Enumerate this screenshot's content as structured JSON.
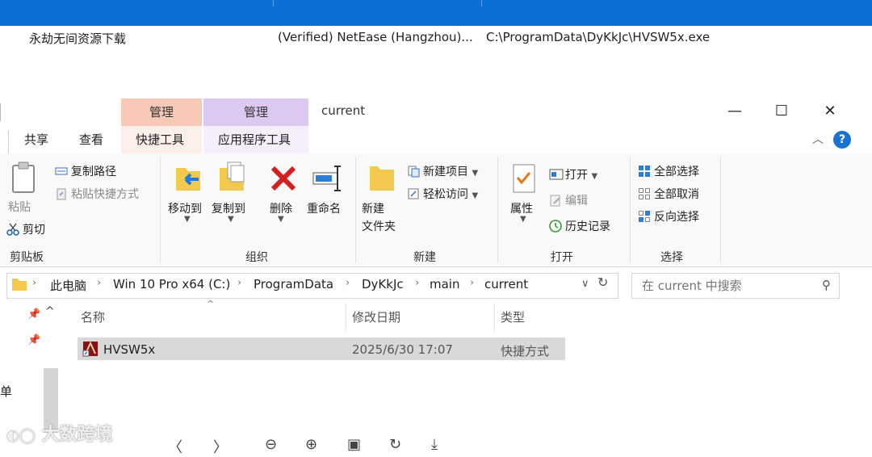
{
  "autoruns": {
    "entry": "永劫无间资源下载",
    "publisher": "(Verified) NetEase (Hangzhou)...",
    "path": "C:\\ProgramData\\DyKkJc\\HVSW5x.exe"
  },
  "window": {
    "title": "current",
    "context_tab_1": "管理",
    "context_tab_2": "管理",
    "minimize": "—",
    "maximize": "☐",
    "close": "✕"
  },
  "tabs": {
    "share": "共享",
    "view": "查看",
    "shortcut_tools": "快捷工具",
    "app_tools": "应用程序工具"
  },
  "ribbon": {
    "clipboard": {
      "paste": "粘贴",
      "copy_path": "复制路径",
      "paste_shortcut": "粘贴快捷方式",
      "cut": "剪切",
      "group": "剪贴板"
    },
    "organize": {
      "move_to": "移动到",
      "copy_to": "复制到",
      "delete": "删除",
      "rename": "重命名",
      "group": "组织"
    },
    "new": {
      "new_folder": "新建\n文件夹",
      "new_item": "新建项目",
      "easy_access": "轻松访问",
      "group": "新建"
    },
    "open": {
      "properties": "属性",
      "open": "打开",
      "edit": "编辑",
      "history": "历史记录",
      "group": "打开"
    },
    "select": {
      "select_all": "全部选择",
      "select_none": "全部取消",
      "invert": "反向选择",
      "group": "选择"
    }
  },
  "address": {
    "crumbs": [
      "此电脑",
      "Win 10 Pro x64 (C:)",
      "ProgramData",
      "DyKkJc",
      "main",
      "current"
    ]
  },
  "search": {
    "placeholder": "在 current 中搜索"
  },
  "columns": {
    "name": "名称",
    "modified": "修改日期",
    "type": "类型"
  },
  "files": [
    {
      "name": "HVSW5x",
      "modified": "2025/6/30 17:07",
      "type": "快捷方式"
    }
  ],
  "nav": {
    "partial_label": "单"
  },
  "watermark": "大数跨境",
  "colors": {
    "accent": "#0a6fd6",
    "context_manage_1": "#f7c9b6",
    "context_manage_2": "#dcc8f0",
    "delete_red": "#d32020"
  }
}
